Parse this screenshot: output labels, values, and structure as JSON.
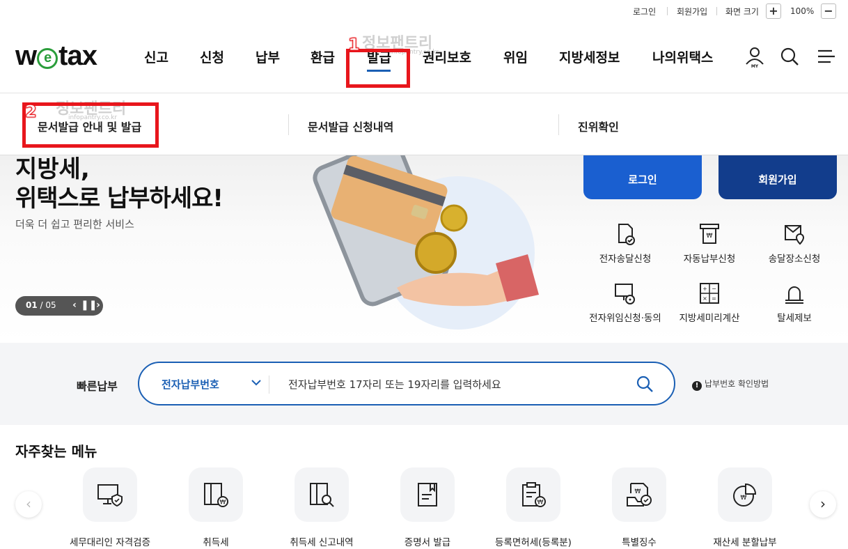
{
  "utility": {
    "login": "로그인",
    "join": "회원가입",
    "zoom_label": "화면 크기",
    "zoom_in": "+",
    "zoom_value": "100%",
    "zoom_out": "−"
  },
  "header": {
    "logo": {
      "w": "w",
      "e": "e",
      "tax": "tax"
    },
    "gnb": [
      "신고",
      "신청",
      "납부",
      "환급",
      "발급",
      "권리보호",
      "위임",
      "지방세정보",
      "나의위택스"
    ],
    "active_menu": "발급",
    "my_label": "MY"
  },
  "submenu": {
    "items": [
      "문서발급 안내 및 발급",
      "문서발급 신청내역",
      "진위확인"
    ]
  },
  "hero": {
    "title_line1": "지방세,",
    "title_line2": "위택스로 납부하세요!",
    "subtitle": "더욱 더 쉽고 편리한 서비스",
    "slide_current": "01",
    "slide_total": "/ 05"
  },
  "account": {
    "login_button": "로그인",
    "join_button": "회원가입"
  },
  "quick_services": [
    {
      "label": "전자송달신청",
      "icon": "document-check-icon"
    },
    {
      "label": "자동납부신청",
      "icon": "auto-pay-icon"
    },
    {
      "label": "송달장소신청",
      "icon": "mail-location-icon"
    },
    {
      "label": "전자위임신청·동의",
      "icon": "monitor-delegate-icon"
    },
    {
      "label": "지방세미리계산",
      "icon": "calculator-icon"
    },
    {
      "label": "탈세제보",
      "icon": "alarm-bell-icon"
    }
  ],
  "quick_pay": {
    "title": "빠른납부",
    "select_value": "전자납부번호",
    "input_placeholder": "전자납부번호 17자리 또는 19자리를 입력하세요",
    "help_link": "납부번호 확인방법"
  },
  "favorites": {
    "title": "자주찾는 메뉴",
    "items": [
      {
        "label": "세무대리인 자격검증",
        "icon": "monitor-shield-icon"
      },
      {
        "label": "취득세",
        "icon": "acquisition-tax-icon"
      },
      {
        "label": "취득세 신고내역",
        "icon": "acquisition-search-icon"
      },
      {
        "label": "증명서 발급",
        "icon": "certificate-icon"
      },
      {
        "label": "등록면허세(등록분)",
        "icon": "clipboard-tax-icon"
      },
      {
        "label": "특별징수",
        "icon": "special-collection-icon"
      },
      {
        "label": "재산세 분할납부",
        "icon": "pie-chart-icon"
      }
    ]
  },
  "annotations": {
    "step1": "1",
    "step2": "2",
    "watermark": "정보팬트리",
    "watermark_sub": "infopantry.co.kr"
  },
  "colors": {
    "primary": "#1a5fb4",
    "login_blue": "#1a5fd0",
    "join_navy": "#123d8c",
    "annotation_red": "#e8161c",
    "logo_green": "#2a9d3a"
  }
}
